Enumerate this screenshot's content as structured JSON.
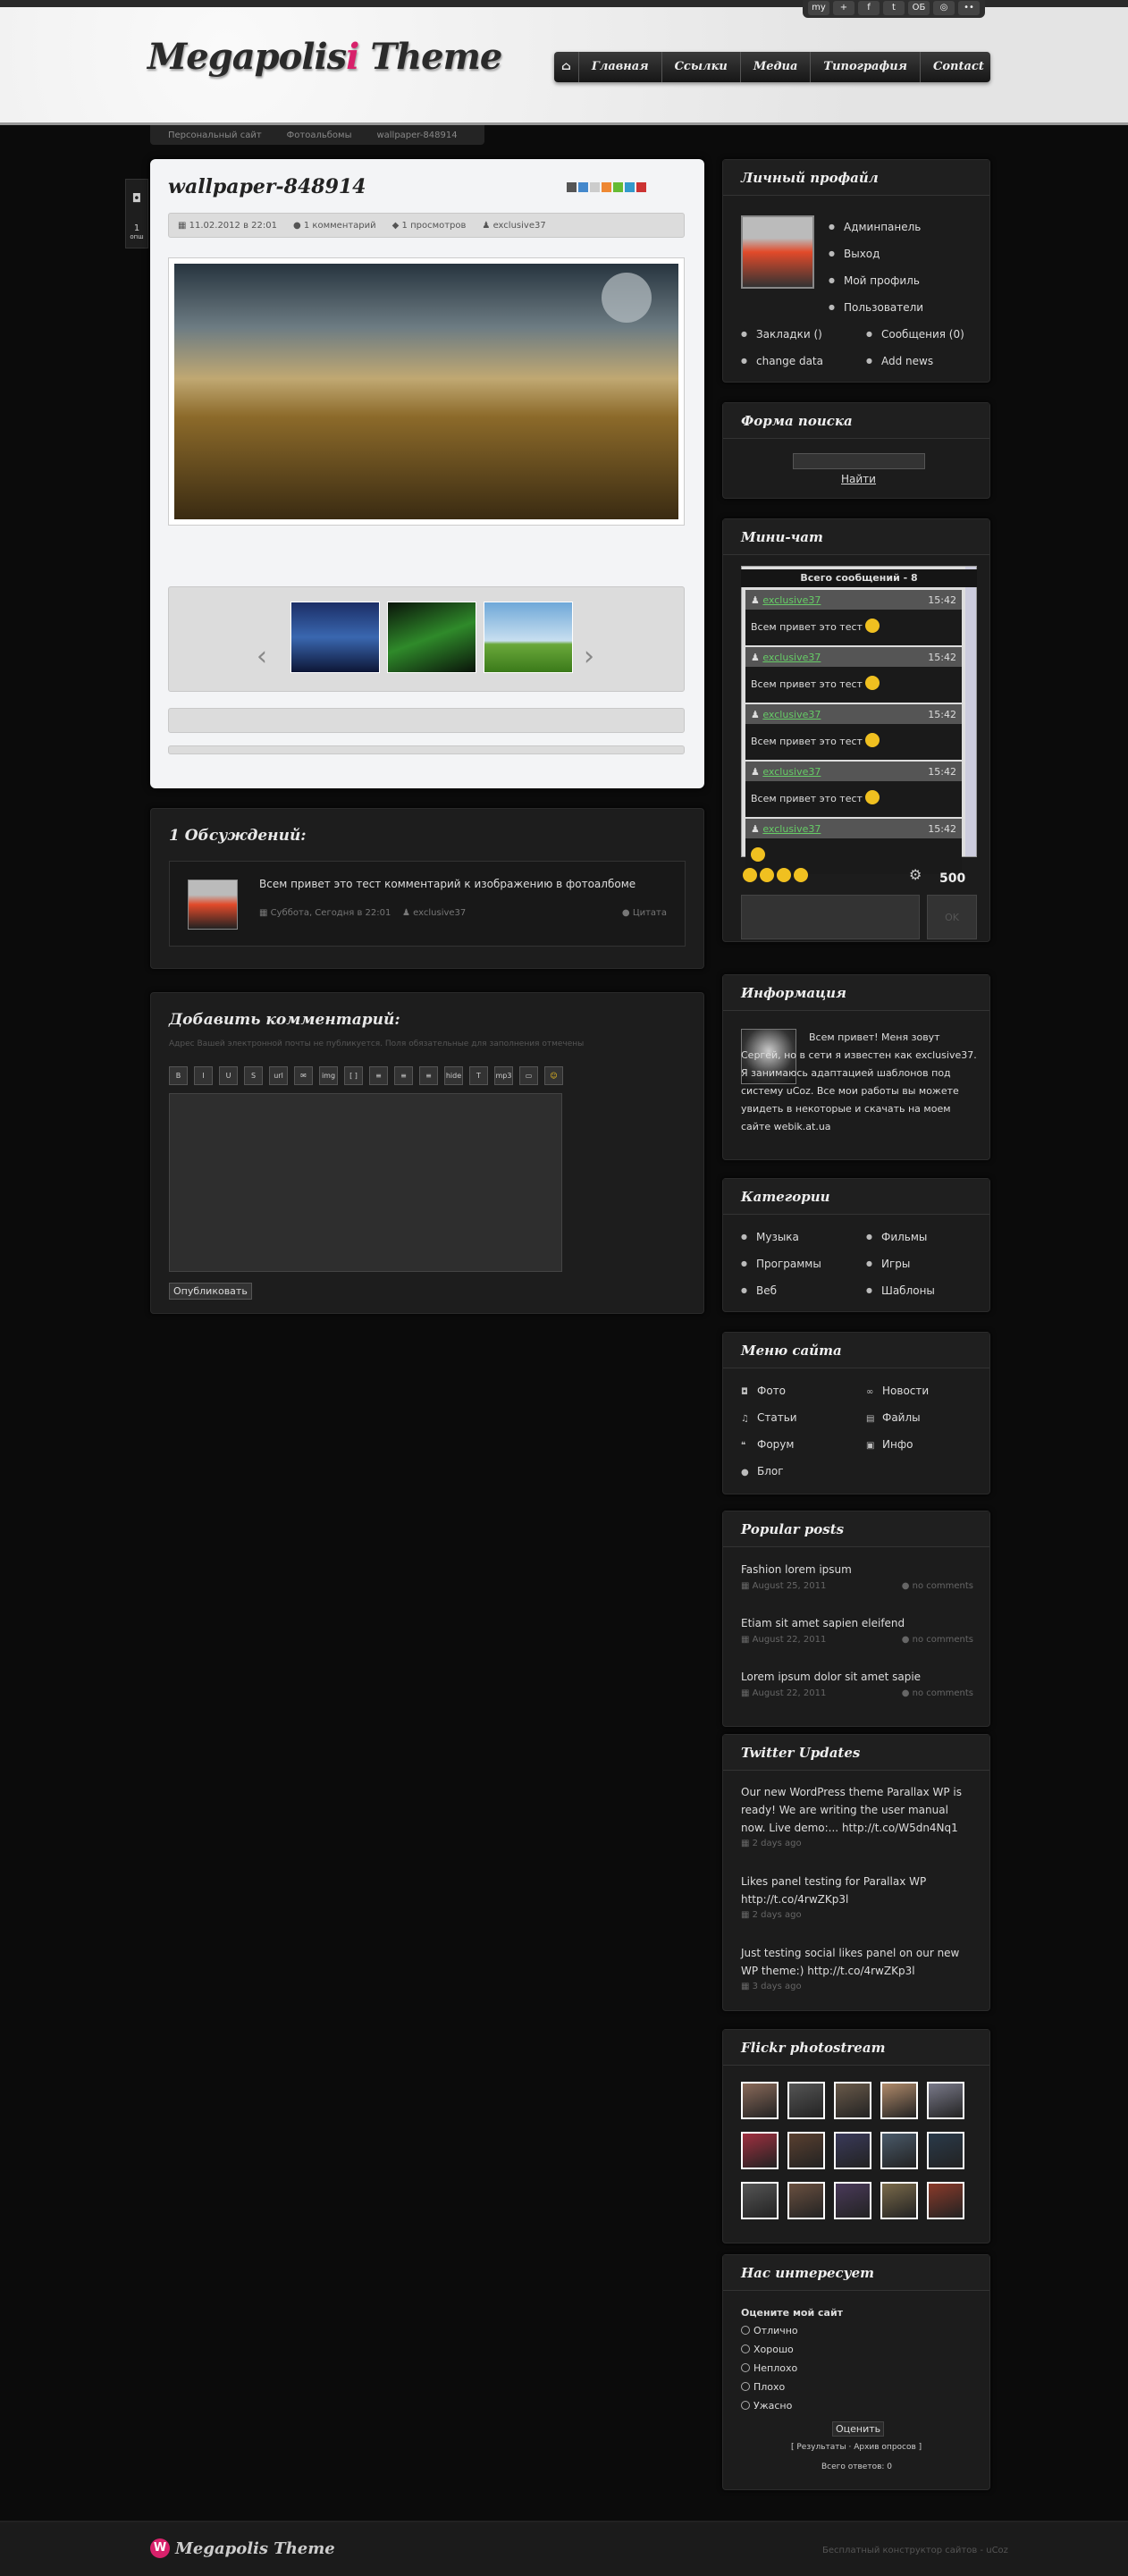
{
  "header": {
    "logo_part1": "Megapolis",
    "logo_part2": "Theme",
    "nav": [
      "Главная",
      "Ссылки",
      "Медиа",
      "Типография",
      "Contact"
    ],
    "social": [
      "my",
      "+",
      "f",
      "t",
      "ОБ",
      "◎",
      "••"
    ]
  },
  "breadcrumbs": [
    "Персональный сайт",
    "Фотоальбомы",
    "wallpaper-848914"
  ],
  "side_tab": {
    "count": "1",
    "label": "опш"
  },
  "post": {
    "title": "wallpaper-848914",
    "date": "11.02.2012 в 22:01",
    "comments": "1 комментарий",
    "views": "1 просмотров",
    "author": "exclusive37"
  },
  "discussion": {
    "title": "1 Обсуждений:",
    "comment_text": "Всем привет это тест комментарий к изображению в фотоалбоме",
    "comment_date": "Суббота, Сегодня в 22:01",
    "comment_author": "exclusive37",
    "quote_label": "Цитата"
  },
  "add_comment": {
    "title": "Добавить комментарий:",
    "note": "Адрес Вашей электронной почты не публикуется. Поля обязательные для заполнения отмечены",
    "toolbar": [
      "B",
      "I",
      "U",
      "S",
      "url",
      "✉",
      "img",
      "[ ]",
      "≡",
      "≡",
      "≡",
      "hide",
      "T",
      "mp3",
      "▭",
      "☺"
    ],
    "submit": "Опубликовать"
  },
  "profile": {
    "title": "Личный профайл",
    "links": [
      "Админпанель",
      "Выход",
      "Мой профиль",
      "Пользователи"
    ],
    "extra": [
      "Закладки ()",
      "Сообщения (0)",
      "change data",
      "Add news"
    ]
  },
  "search": {
    "title": "Форма поиска",
    "button": "Найти"
  },
  "chat": {
    "title": "Мини-чат",
    "total": "Всего сообщений - 8",
    "messages": [
      {
        "user": "exclusive37",
        "time": "15:42",
        "text": "Всем привет это тест"
      },
      {
        "user": "exclusive37",
        "time": "15:42",
        "text": "Всем привет это тест"
      },
      {
        "user": "exclusive37",
        "time": "15:42",
        "text": "Всем привет это тест"
      },
      {
        "user": "exclusive37",
        "time": "15:42",
        "text": "Всем привет это тест"
      },
      {
        "user": "exclusive37",
        "time": "15:42",
        "text": ""
      }
    ],
    "limit": "500",
    "ok": "OK"
  },
  "info": {
    "title": "Информация",
    "text": "Всем привет! Меня зовут Сергей, но в сети я известен как exclusive37. Я занимаюсь адаптацией шаблонов под систему uCoz. Все мои работы вы можете увидеть в некоторые и скачать на моем сайте webik.at.ua"
  },
  "categories": {
    "title": "Категории",
    "items": [
      "Музыка",
      "Фильмы",
      "Программы",
      "Игры",
      "Веб",
      "Шаблоны"
    ]
  },
  "site_menu": {
    "title": "Меню сайта",
    "items": [
      {
        "label": "Фото",
        "icon": "camera-icon"
      },
      {
        "label": "Новости",
        "icon": "link-icon"
      },
      {
        "label": "Статьи",
        "icon": "music-icon"
      },
      {
        "label": "Файлы",
        "icon": "file-icon"
      },
      {
        "label": "Форум",
        "icon": "quote-icon"
      },
      {
        "label": "Инфо",
        "icon": "image-icon"
      },
      {
        "label": "Блог",
        "icon": "chat-icon"
      }
    ]
  },
  "popular": {
    "title": "Popular posts",
    "posts": [
      {
        "title": "Fashion lorem ipsum",
        "date": "August 25, 2011",
        "comments": "no comments"
      },
      {
        "title": "Etiam sit amet sapien eleifend",
        "date": "August 22, 2011",
        "comments": "no comments"
      },
      {
        "title": "Lorem ipsum dolor sit amet sapie",
        "date": "August 22, 2011",
        "comments": "no comments"
      }
    ]
  },
  "twitter": {
    "title": "Twitter Updates",
    "tweets": [
      {
        "text": "Our new WordPress theme Parallax WP is ready! We are writing the user manual now. Live demo:... http://t.co/W5dn4Nq1",
        "when": "2 days ago"
      },
      {
        "text": "Likes panel testing for Parallax WP http://t.co/4rwZKp3l",
        "when": "2 days ago"
      },
      {
        "text": "Just testing social likes panel on our new WP theme:) http://t.co/4rwZKp3l",
        "when": "3 days ago"
      }
    ]
  },
  "flickr": {
    "title": "Flickr photostream"
  },
  "poll": {
    "title": "Нас интересует",
    "question": "Оцените мой сайт",
    "options": [
      "Отлично",
      "Хорошо",
      "Неплохо",
      "Плохо",
      "Ужасно"
    ],
    "button": "Оценить",
    "results": "Результаты",
    "archive": "Архив опросов",
    "total": "Всего ответов: 0"
  },
  "footer": {
    "logo": "Megapolis Theme",
    "credit": "Бесплатный конструктор сайтов - uCoz"
  },
  "colors": {
    "accent": "#d8216b",
    "chat_user": "#66cc66"
  }
}
